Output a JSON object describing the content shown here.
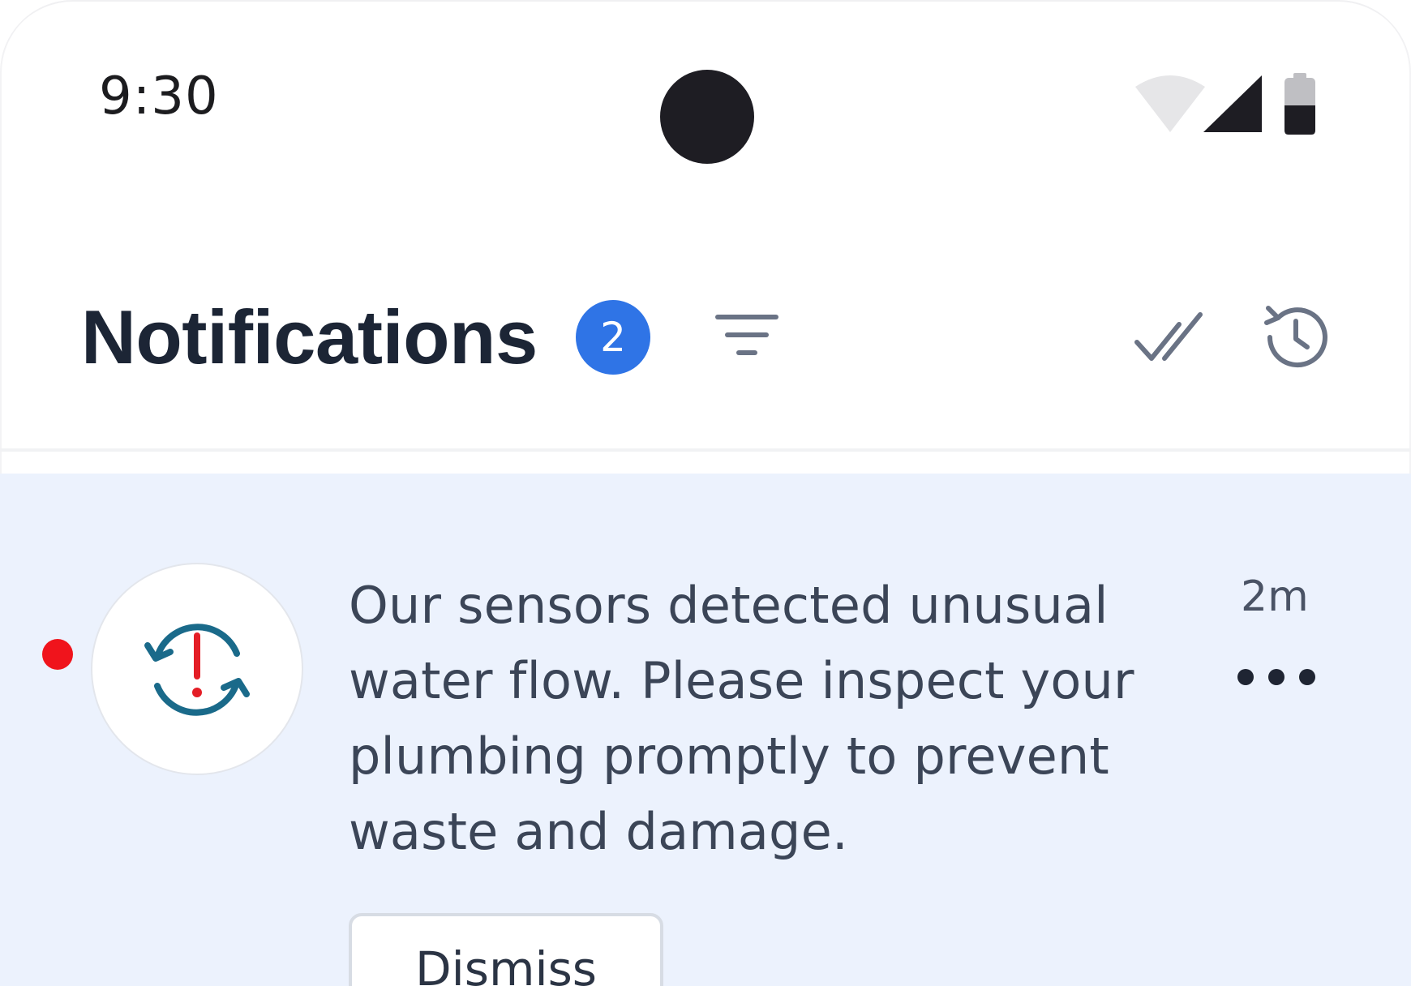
{
  "status_bar": {
    "time": "9:30",
    "icons": [
      "wifi-icon",
      "cellular-signal-icon",
      "battery-icon"
    ]
  },
  "header": {
    "title": "Notifications",
    "unread_count": "2",
    "actions": [
      "filter-icon",
      "mark-all-read-icon",
      "history-icon"
    ]
  },
  "notifications": [
    {
      "unread": true,
      "icon": "water-flow-alert-icon",
      "message": "Our sensors detected unusual water flow. Please inspect your plumbing promptly to prevent waste and damage.",
      "time": "2m",
      "action_label": "Dismiss"
    }
  ],
  "colors": {
    "badge": "#2f74e6",
    "unread_dot": "#f0141c",
    "card_background": "#ecf2fd",
    "icon_blue": "#1a6a8a",
    "icon_red": "#e41e26"
  }
}
